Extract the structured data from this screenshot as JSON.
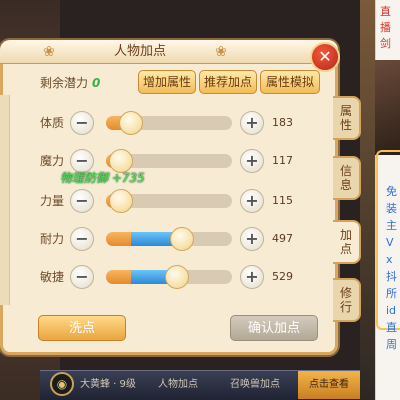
{
  "panel": {
    "title": "人物加点",
    "close_icon": "close-icon"
  },
  "potential": {
    "label": "剩余潜力",
    "value": "0"
  },
  "buttons": {
    "add_attr": "增加属性",
    "recommend": "推荐加点",
    "simulate": "属性模拟",
    "wash": "洗点",
    "confirm": "确认加点"
  },
  "attributes": [
    {
      "label": "体质",
      "value": "183",
      "orange_fraction": 0.2,
      "blue_fraction": 0.0,
      "knob_fraction": 0.2
    },
    {
      "label": "魔力",
      "value": "117",
      "orange_fraction": 0.12,
      "blue_fraction": 0.0,
      "knob_fraction": 0.12
    },
    {
      "label": "力量",
      "value": "115",
      "orange_fraction": 0.12,
      "blue_fraction": 0.0,
      "knob_fraction": 0.12
    },
    {
      "label": "耐力",
      "value": "497",
      "orange_fraction": 0.2,
      "blue_fraction": 0.4,
      "knob_fraction": 0.6
    },
    {
      "label": "敏捷",
      "value": "529",
      "orange_fraction": 0.2,
      "blue_fraction": 0.35,
      "knob_fraction": 0.56
    }
  ],
  "float_text": "物理防御 +735",
  "side_tabs": [
    {
      "label": "属\n性",
      "active": false
    },
    {
      "label": "信\n息",
      "active": false
    },
    {
      "label": "加\n点",
      "active": true
    },
    {
      "label": "修\n行",
      "active": false
    }
  ],
  "bottom_bar": {
    "item1": "大黄蜂 · 9级",
    "item2": "人物加点",
    "item3": "召唤兽加点",
    "item4": "点击查看"
  },
  "ad": {
    "title": "直播剑",
    "text": "免装主Vx抖所id直周"
  },
  "colors": {
    "panel_bg": "#f7ecd3",
    "border": "#d8a65c",
    "accent_orange": "#e58a2c",
    "accent_blue": "#2b8ad6",
    "close_red": "#d9342b",
    "green_text": "#33b14a"
  }
}
